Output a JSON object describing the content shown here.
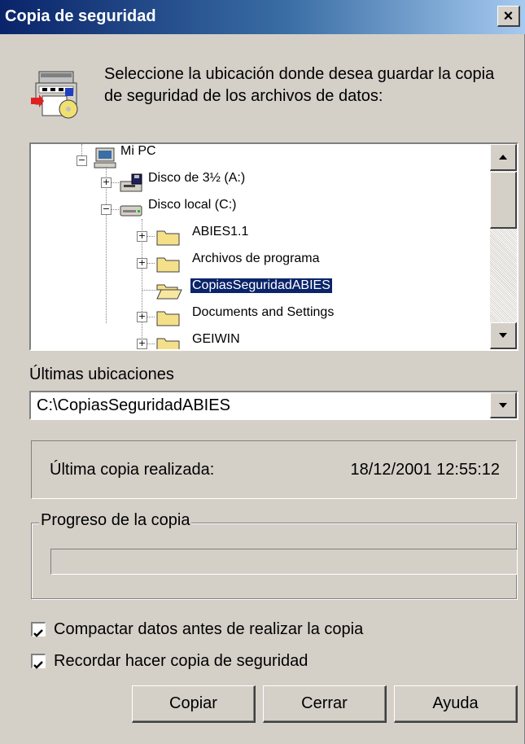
{
  "window": {
    "title": "Copia de seguridad",
    "close_glyph": "✕"
  },
  "header": {
    "icon": "backup-drive-icon",
    "instructions": "Seleccione la ubicación donde desea guardar la copia de seguridad de los archivos de datos:"
  },
  "tree": {
    "items": [
      {
        "label": "Mi PC",
        "icon": "computer-icon",
        "expander": "−",
        "selected": false
      },
      {
        "label": "Disco de 3½ (A:)",
        "icon": "floppy-drive-icon",
        "expander": "+",
        "selected": false
      },
      {
        "label": "Disco local (C:)",
        "icon": "hard-drive-icon",
        "expander": "−",
        "selected": false
      },
      {
        "label": "ABIES1.1",
        "icon": "folder-icon",
        "expander": "+",
        "selected": false
      },
      {
        "label": "Archivos de programa",
        "icon": "folder-icon",
        "expander": "+",
        "selected": false
      },
      {
        "label": "CopiasSeguridadABIES",
        "icon": "folder-open-icon",
        "expander": "",
        "selected": true
      },
      {
        "label": "Documents and Settings",
        "icon": "folder-icon",
        "expander": "+",
        "selected": false
      },
      {
        "label": "GEIWIN",
        "icon": "folder-icon",
        "expander": "+",
        "selected": false
      }
    ]
  },
  "recent": {
    "label": "Últimas ubicaciones",
    "value": "C:\\CopiasSeguridadABIES"
  },
  "last_copy": {
    "label": "Última copia realizada:",
    "value": "18/12/2001 12:55:12"
  },
  "progress": {
    "title": "Progreso de la copia",
    "fraction": 0
  },
  "options": {
    "compact_label": "Compactar datos antes de realizar la copia",
    "compact_checked": true,
    "remind_label": "Recordar hacer copia de seguridad",
    "remind_checked": true
  },
  "buttons": {
    "copy": "Copiar",
    "close": "Cerrar",
    "help": "Ayuda"
  }
}
